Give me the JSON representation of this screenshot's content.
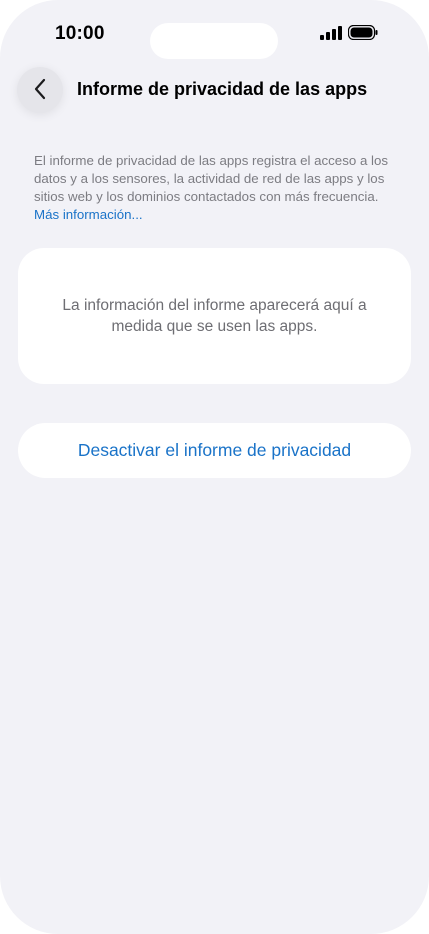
{
  "status_bar": {
    "time": "10:00",
    "icons": [
      "cellular-signal-icon",
      "battery-icon"
    ]
  },
  "nav": {
    "back_icon": "chevron-left-icon",
    "title": "Informe de privacidad de las apps"
  },
  "description": {
    "text": "El informe de privacidad de las apps registra el acceso a los datos y a los sensores, la actividad de red de las apps y los sitios web y los dominios contactados con más frecuencia.",
    "link_label": "Más información..."
  },
  "info_card": {
    "text": "La información del informe aparecerá aquí a medida que se usen las apps."
  },
  "actions": {
    "disable_label": "Desactivar el informe de privacidad"
  },
  "colors": {
    "background": "#f2f2f7",
    "card": "#ffffff",
    "accent": "#1a73c8",
    "secondary_text": "#7c7c82"
  }
}
